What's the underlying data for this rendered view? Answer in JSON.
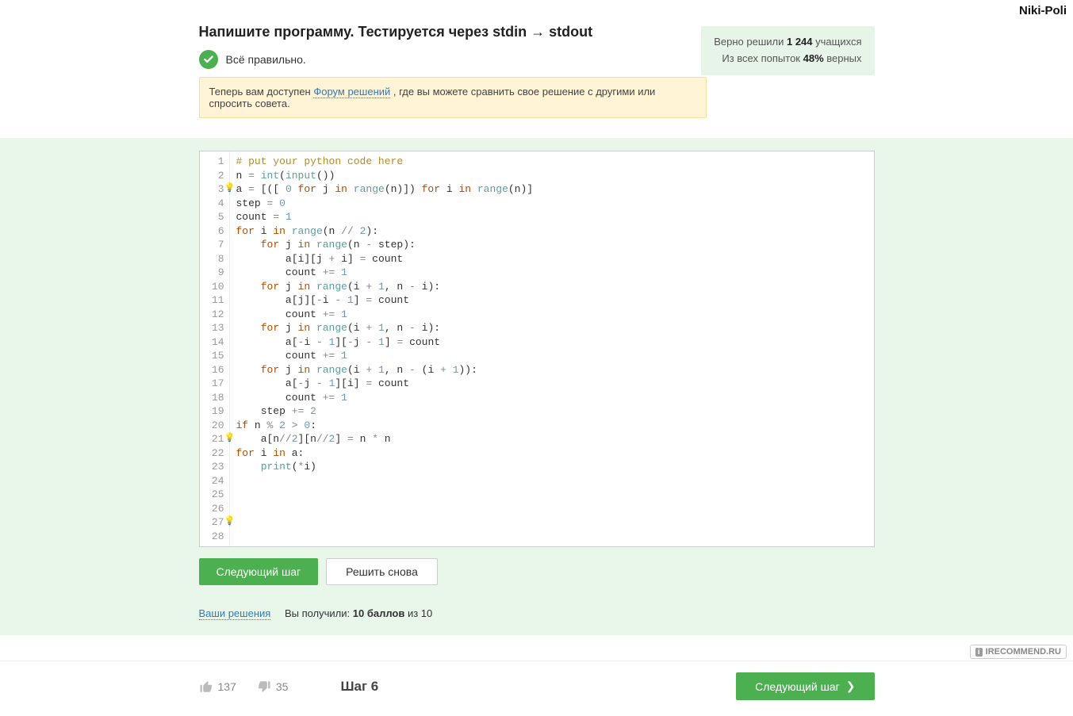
{
  "user_name": "Niki-Poli",
  "title": "Напишите программу. Тестируется через stdin → stdout",
  "correct": {
    "label": "Всё правильно."
  },
  "stats": {
    "solved_prefix": "Верно решили ",
    "solved_count": "1 244",
    "solved_suffix": " учащихся",
    "attempts_prefix": "Из всех попыток ",
    "attempts_pct": "48%",
    "attempts_suffix": " верных"
  },
  "notice": {
    "prefix": "Теперь вам доступен ",
    "link": "Форум решений",
    "suffix": " , где вы можете сравнить свое решение с другими или спросить совета."
  },
  "code": {
    "line_count": 28,
    "bulb_lines": [
      3,
      21,
      27
    ],
    "lines": [
      {
        "type": "comment",
        "text": "# put your python code here"
      },
      {
        "type": "plain",
        "html": "n <span class='tok-op'>=</span> <span class='tok-fn'>int</span>(<span class='tok-fn'>input</span>())"
      },
      {
        "type": "plain",
        "html": "a <span class='tok-op'>=</span> [([ <span class='tok-num'>0</span> <span class='tok-kw'>for</span> j <span class='tok-kw'>in</span> <span class='tok-fn'>range</span>(n)]) <span class='tok-kw'>for</span> i <span class='tok-kw'>in</span> <span class='tok-fn'>range</span>(n)]"
      },
      {
        "type": "plain",
        "html": "step <span class='tok-op'>=</span> <span class='tok-num'>0</span>"
      },
      {
        "type": "plain",
        "html": "count <span class='tok-op'>=</span> <span class='tok-num'>1</span>"
      },
      {
        "type": "plain",
        "html": "<span class='tok-kw'>for</span> i <span class='tok-kw'>in</span> <span class='tok-fn'>range</span>(n <span class='tok-op'>//</span> <span class='tok-num'>2</span>):"
      },
      {
        "type": "plain",
        "html": "    <span class='tok-kw'>for</span> j <span class='tok-kw'>in</span> <span class='tok-fn'>range</span>(n <span class='tok-op'>-</span> step):"
      },
      {
        "type": "plain",
        "html": "        a[i][j <span class='tok-op'>+</span> i] <span class='tok-op'>=</span> count"
      },
      {
        "type": "plain",
        "html": "        count <span class='tok-op'>+=</span> <span class='tok-num'>1</span>"
      },
      {
        "type": "plain",
        "html": "    <span class='tok-kw'>for</span> j <span class='tok-kw'>in</span> <span class='tok-fn'>range</span>(i <span class='tok-op'>+</span> <span class='tok-num'>1</span>, n <span class='tok-op'>-</span> i):"
      },
      {
        "type": "plain",
        "html": "        a[j][<span class='tok-op'>-</span>i <span class='tok-op'>-</span> <span class='tok-num'>1</span>] <span class='tok-op'>=</span> count"
      },
      {
        "type": "plain",
        "html": "        count <span class='tok-op'>+=</span> <span class='tok-num'>1</span>"
      },
      {
        "type": "plain",
        "html": "    <span class='tok-kw'>for</span> j <span class='tok-kw'>in</span> <span class='tok-fn'>range</span>(i <span class='tok-op'>+</span> <span class='tok-num'>1</span>, n <span class='tok-op'>-</span> i):"
      },
      {
        "type": "plain",
        "html": "        a[<span class='tok-op'>-</span>i <span class='tok-op'>-</span> <span class='tok-num'>1</span>][<span class='tok-op'>-</span>j <span class='tok-op'>-</span> <span class='tok-num'>1</span>] <span class='tok-op'>=</span> count"
      },
      {
        "type": "plain",
        "html": "        count <span class='tok-op'>+=</span> <span class='tok-num'>1</span>"
      },
      {
        "type": "plain",
        "html": "    <span class='tok-kw'>for</span> j <span class='tok-kw'>in</span> <span class='tok-fn'>range</span>(i <span class='tok-op'>+</span> <span class='tok-num'>1</span>, n <span class='tok-op'>-</span> (i <span class='tok-op'>+</span> <span class='tok-num'>1</span>)):"
      },
      {
        "type": "plain",
        "html": "        a[<span class='tok-op'>-</span>j <span class='tok-op'>-</span> <span class='tok-num'>1</span>][i] <span class='tok-op'>=</span> count"
      },
      {
        "type": "plain",
        "html": "        count <span class='tok-op'>+=</span> <span class='tok-num'>1</span>"
      },
      {
        "type": "plain",
        "html": "    step <span class='tok-op'>+=</span> <span class='tok-num'>2</span>"
      },
      {
        "type": "plain",
        "html": "<span class='tok-kw'>if</span> n <span class='tok-op'>%</span> <span class='tok-num'>2</span> <span class='tok-op'>&gt;</span> <span class='tok-num'>0</span>:"
      },
      {
        "type": "plain",
        "html": "    a[n<span class='tok-op'>//</span><span class='tok-num'>2</span>][n<span class='tok-op'>//</span><span class='tok-num'>2</span>] <span class='tok-op'>=</span> n <span class='tok-op'>*</span> n"
      },
      {
        "type": "plain",
        "html": "<span class='tok-kw'>for</span> i <span class='tok-kw'>in</span> a:"
      },
      {
        "type": "plain",
        "html": "    <span class='tok-fn'>print</span>(<span class='tok-op'>*</span>i)"
      },
      {
        "type": "plain",
        "html": ""
      },
      {
        "type": "plain",
        "html": ""
      },
      {
        "type": "plain",
        "html": ""
      },
      {
        "type": "plain",
        "html": ""
      },
      {
        "type": "plain",
        "html": ""
      }
    ]
  },
  "buttons": {
    "next_step": "Следующий шаг",
    "solve_again": "Решить снова"
  },
  "score": {
    "link": "Ваши решения",
    "received_prefix": "Вы получили: ",
    "points": "10 баллов",
    "suffix": " из 10"
  },
  "footer": {
    "likes": "137",
    "dislikes": "35",
    "step_label": "Шаг 6",
    "next_btn": "Следующий шаг"
  },
  "watermark": {
    "text": "IRECOMMEND.RU"
  }
}
